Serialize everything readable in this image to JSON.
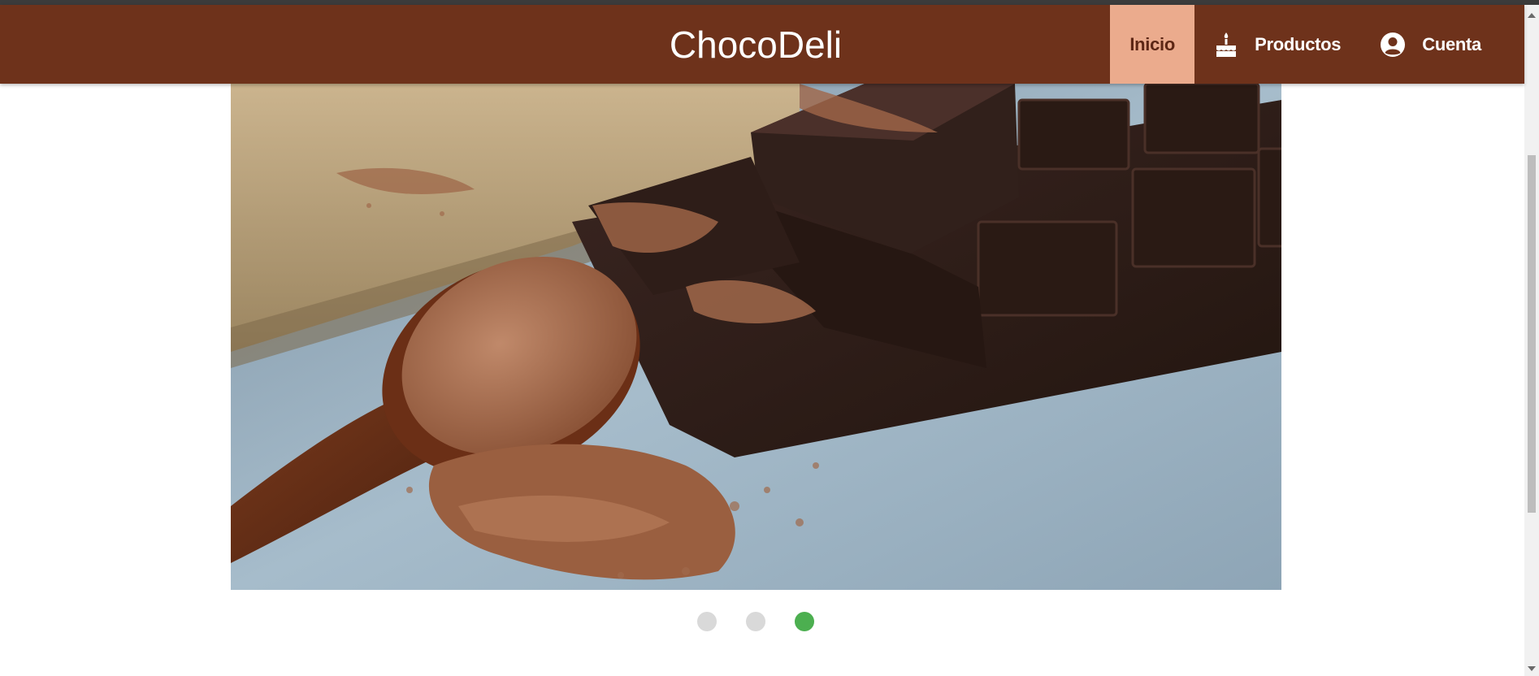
{
  "header": {
    "brand": "ChocoDeli",
    "nav": {
      "home": "Inicio",
      "products": "Productos",
      "account": "Cuenta"
    }
  },
  "carousel": {
    "slide_count": 3,
    "active_index": 2
  },
  "colors": {
    "header_bg": "#6e321b",
    "active_tab_bg": "#ebab8d",
    "active_dot": "#4caf50",
    "inactive_dot": "#d9d9d9"
  },
  "icons": {
    "products": "cake-icon",
    "account": "user-circle-icon"
  }
}
